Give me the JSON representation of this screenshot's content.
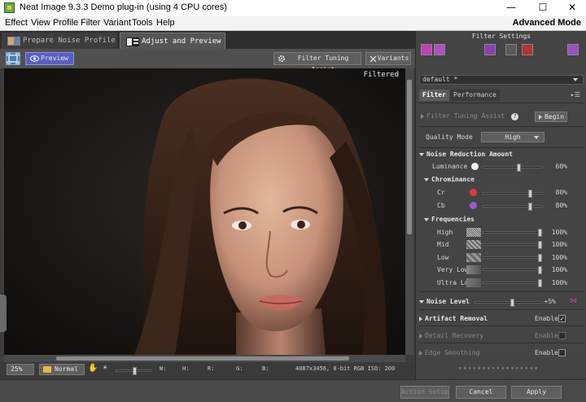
{
  "window": {
    "title": "Neat Image 9.3.3 Demo plug-in (using 4 CPU cores)",
    "minimize": "—",
    "maximize": "☐",
    "close": "✕"
  },
  "menu": [
    "Effect",
    "View",
    "Profile",
    "Filter",
    "Variant",
    "Tools",
    "Help"
  ],
  "mode_label": "Advanced Mode",
  "tabs": {
    "prepare": "Prepare Noise Profile",
    "adjust": "Adjust and Preview"
  },
  "toolbar": {
    "preview": "Preview",
    "tuning_assist": "Filter Tuning Assist",
    "variants": "Variants"
  },
  "image": {
    "overlay_label": "Filtered"
  },
  "status": {
    "zoom": "25%",
    "blend": "Normal",
    "w": "W:",
    "h": "H:",
    "r": "R:",
    "g": "G:",
    "b": "B:",
    "info": "4087x3456, 8-bit RGB  ISO: 200"
  },
  "panel": {
    "title": "Filter Settings",
    "preset": "default *",
    "tab_filter": "Filter",
    "tab_performance": "Performance",
    "tuning_label": "Filter Tuning Assist",
    "begin": "Begin",
    "quality_label": "Quality Mode",
    "quality_value": "High",
    "nr_title": "Noise Reduction Amount",
    "luminance": {
      "label": "Luminance",
      "value": "60%",
      "level": 0.6
    },
    "chrominance": "Chrominance",
    "cr": {
      "label": "Cr",
      "value": "80%",
      "level": 0.8,
      "color": "#e23a3a"
    },
    "cb": {
      "label": "Cb",
      "value": "80%",
      "level": 0.8,
      "color": "#9b59d6"
    },
    "frequencies": "Frequencies",
    "freq": [
      {
        "label": "High",
        "value": "100%",
        "level": 1.0
      },
      {
        "label": "Mid",
        "value": "100%",
        "level": 1.0
      },
      {
        "label": "Low",
        "value": "100%",
        "level": 1.0
      },
      {
        "label": "Very Low",
        "value": "100%",
        "level": 1.0
      },
      {
        "label": "Ultra Low",
        "value": "100%",
        "level": 1.0
      }
    ],
    "noise_level": {
      "label": "Noise Level",
      "value": "+5%",
      "level": 0.55
    },
    "artifact": {
      "label": "Artifact Removal",
      "enable": "Enable",
      "checked": "✓"
    },
    "detail": {
      "label": "Detail Recovery",
      "enable": "Enable"
    },
    "edge": {
      "label": "Edge Smoothing",
      "enable": "Enable"
    }
  },
  "footer": {
    "action_setup": "Action Setup",
    "cancel": "Cancel",
    "apply": "Apply"
  }
}
